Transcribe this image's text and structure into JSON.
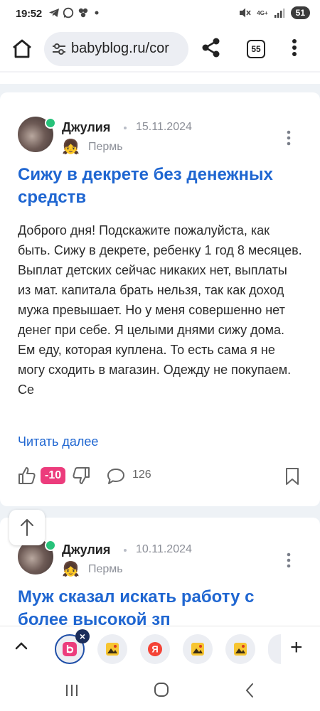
{
  "status_bar": {
    "time": "19:52",
    "network": "4G+",
    "battery": "51"
  },
  "toolbar": {
    "url": "babyblog.ru/cor",
    "tab_count": "55"
  },
  "posts": [
    {
      "author": "Джулия",
      "date": "15.11.2024",
      "city": "Пермь",
      "title": "Сижу в декрете без денежных средств",
      "body": "Доброго дня! Подскажите пожалуйста, как быть. Сижу в декрете, ребенку 1 год 8 месяцев. Выплат детских сейчас никаких нет, выплаты из мат. капитала брать нельзя, так как доход мужа превышает. Но у меня совершенно нет денег при себе. Я целыми днями сижу дома. Ем еду, которая куплена. То есть сама я не могу сходить в магазин. Одежду не покупаем. Се",
      "read_more": "Читать далее",
      "score": "-10",
      "comments": "126"
    },
    {
      "author": "Джулия",
      "date": "10.11.2024",
      "city": "Пермь",
      "title": "Муж сказал искать работу с более высокой зп"
    }
  ],
  "tab_strip": {
    "icons": [
      "babyblog-tab-icon",
      "image-tab-icon",
      "yandex-tab-icon",
      "image-tab-icon",
      "image-tab-icon"
    ],
    "yandex_letter": "Я",
    "close_label": "×",
    "plus_label": "+"
  },
  "colors": {
    "accent": "#1f66d1",
    "score_badge": "#ec3c7c",
    "online": "#27c27a"
  }
}
